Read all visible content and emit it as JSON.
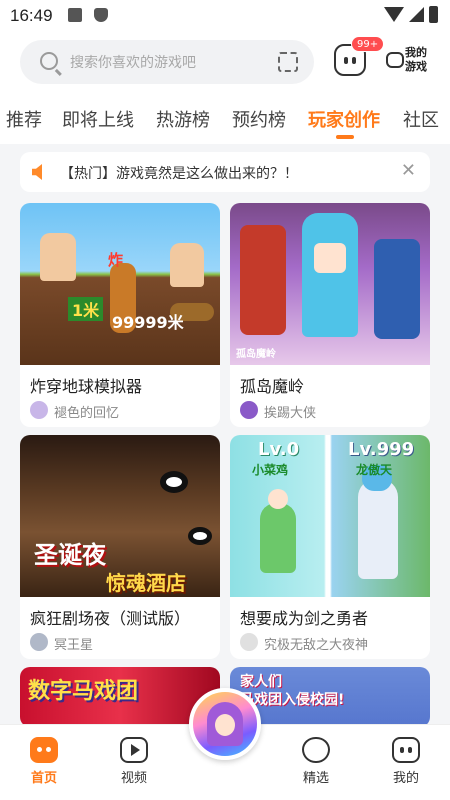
{
  "status": {
    "time": "16:49"
  },
  "search": {
    "placeholder": "搜索你喜欢的游戏吧"
  },
  "header": {
    "badge": "99+",
    "my_games": "我的游戏"
  },
  "tabs": [
    {
      "label": "推荐",
      "active": false
    },
    {
      "label": "即将上线",
      "active": false
    },
    {
      "label": "热游榜",
      "active": false
    },
    {
      "label": "预约榜",
      "active": false
    },
    {
      "label": "玩家创作",
      "active": true
    },
    {
      "label": "社区",
      "active": false
    }
  ],
  "notice": {
    "text": "【热门】游戏竟然是这么做出来的？！",
    "close": "✕"
  },
  "cards": [
    {
      "title": "炸穿地球模拟器",
      "author": "褪色的回忆",
      "art": {
        "tag1": "炸",
        "tag2": "1米",
        "tag3": "99999米"
      }
    },
    {
      "title": "孤岛魔岭",
      "author": "挨踢大侠",
      "art": {
        "tag1": "孤岛魔岭"
      }
    },
    {
      "title": "疯狂剧场夜（测试版）",
      "author": "冥王星",
      "art": {
        "tag1": "圣诞夜",
        "tag2": "惊魂酒店"
      }
    },
    {
      "title": "想要成为剑之勇者",
      "author": "究极无敌之大夜神",
      "art": {
        "tag1": "Lv.0",
        "tag2": "小菜鸡",
        "tag3": "Lv.999",
        "tag4": "龙傲天"
      }
    },
    {
      "title": "",
      "author": "",
      "art": {
        "tag1": "数字马戏团"
      }
    },
    {
      "title": "",
      "author": "",
      "art": {
        "tag1": "家人们",
        "tag2": "马戏团入侵校园!"
      }
    }
  ],
  "nav": [
    {
      "label": "首页",
      "active": true
    },
    {
      "label": "视频",
      "active": false
    },
    {
      "label": "精选",
      "active": false
    },
    {
      "label": "我的",
      "active": false
    }
  ],
  "colors": {
    "accent": "#ff7a1a",
    "badge": "#ff4d4f",
    "background": "#f4f5f7"
  }
}
